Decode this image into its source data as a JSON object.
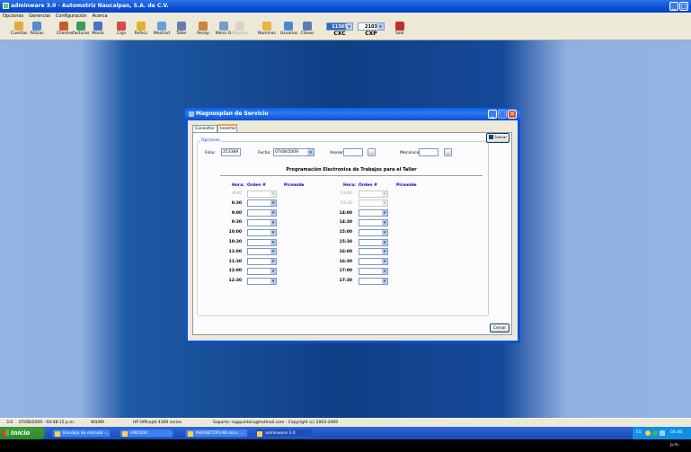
{
  "app": {
    "title": "adminware 3.0 - Automotriz Naucalpan, S.A. de C.V.",
    "menu": [
      "Opciones",
      "Gerencial",
      "Configuración",
      "Acerca"
    ],
    "toolbar": [
      "Cuentas",
      "Pólizas",
      "Clientes",
      "Facturas",
      "Movts",
      "Caja",
      "Refacc",
      "Mostrad",
      "Taller",
      "Recep",
      "Mano O.",
      "Magnus",
      "Nominas",
      "Usuarios",
      "Claves"
    ],
    "toolbar_disabled": [
      "Magnus"
    ],
    "combos": [
      {
        "value": "11365",
        "label": "CXC"
      },
      {
        "value": "2103",
        "label": "CXP"
      }
    ],
    "exit_label": "Salir"
  },
  "dialog": {
    "title": "Magnosplan de Servicio",
    "tabs": [
      "Consultar",
      "Insertar"
    ],
    "active_tab": "Insertar",
    "group_label": "Opciones",
    "folio_label": "Folio:",
    "folio_value": "253389",
    "fecha_label": "Fecha:",
    "fecha_value": "07/08/2009",
    "asesor_label": "Asesor",
    "asesor_value": "",
    "mecanico_label": "Mecanico",
    "mecanico_value": "",
    "lookup_glyph": "...",
    "save_label": "Salvar",
    "plan_title": "Programación Electronica de Trabajos para el Taller",
    "col_hora": "Hora:",
    "col_orden": "Orden #",
    "col_piramide": "Piramide",
    "left_hours": [
      {
        "time": "8:00",
        "enabled": false
      },
      {
        "time": "8:30",
        "enabled": true
      },
      {
        "time": "9:00",
        "enabled": true
      },
      {
        "time": "9:30",
        "enabled": true
      },
      {
        "time": "10:00",
        "enabled": true
      },
      {
        "time": "10:30",
        "enabled": true
      },
      {
        "time": "11:00",
        "enabled": true
      },
      {
        "time": "11:30",
        "enabled": true
      },
      {
        "time": "12:00",
        "enabled": true
      },
      {
        "time": "12:30",
        "enabled": true
      }
    ],
    "right_hours": [
      {
        "time": "13:00",
        "enabled": false
      },
      {
        "time": "13:30",
        "enabled": false
      },
      {
        "time": "14:00",
        "enabled": true
      },
      {
        "time": "14:30",
        "enabled": true
      },
      {
        "time": "15:00",
        "enabled": true
      },
      {
        "time": "15:30",
        "enabled": true
      },
      {
        "time": "16:00",
        "enabled": true
      },
      {
        "time": "16:30",
        "enabled": true
      },
      {
        "time": "17:00",
        "enabled": true
      },
      {
        "time": "17:30",
        "enabled": true
      }
    ],
    "close_label": "Cerrar"
  },
  "statusbar": {
    "version": "3.0",
    "datetime": "07/08/2009 - 04:48:15 p.m.",
    "user": "WILMA",
    "printer": "HP Officejet 4300 series",
    "support": "Soporte: rogquintero@hotmail.com - Copyright (c) 2003-2009"
  },
  "taskbar": {
    "start": "Inicio",
    "tasks": [
      "Bandeja de entrada -...",
      "VW1400",
      "MAGNETOPLAN.docx ...",
      "adminware 3.0"
    ],
    "active_task": "adminware 3.0",
    "tray_lang": "ES",
    "tray_time": "04:48 p.m."
  },
  "colors": {
    "accent": "#0b50d8",
    "header_blue": "#0000c8",
    "desktop": "#1f5aa6"
  }
}
